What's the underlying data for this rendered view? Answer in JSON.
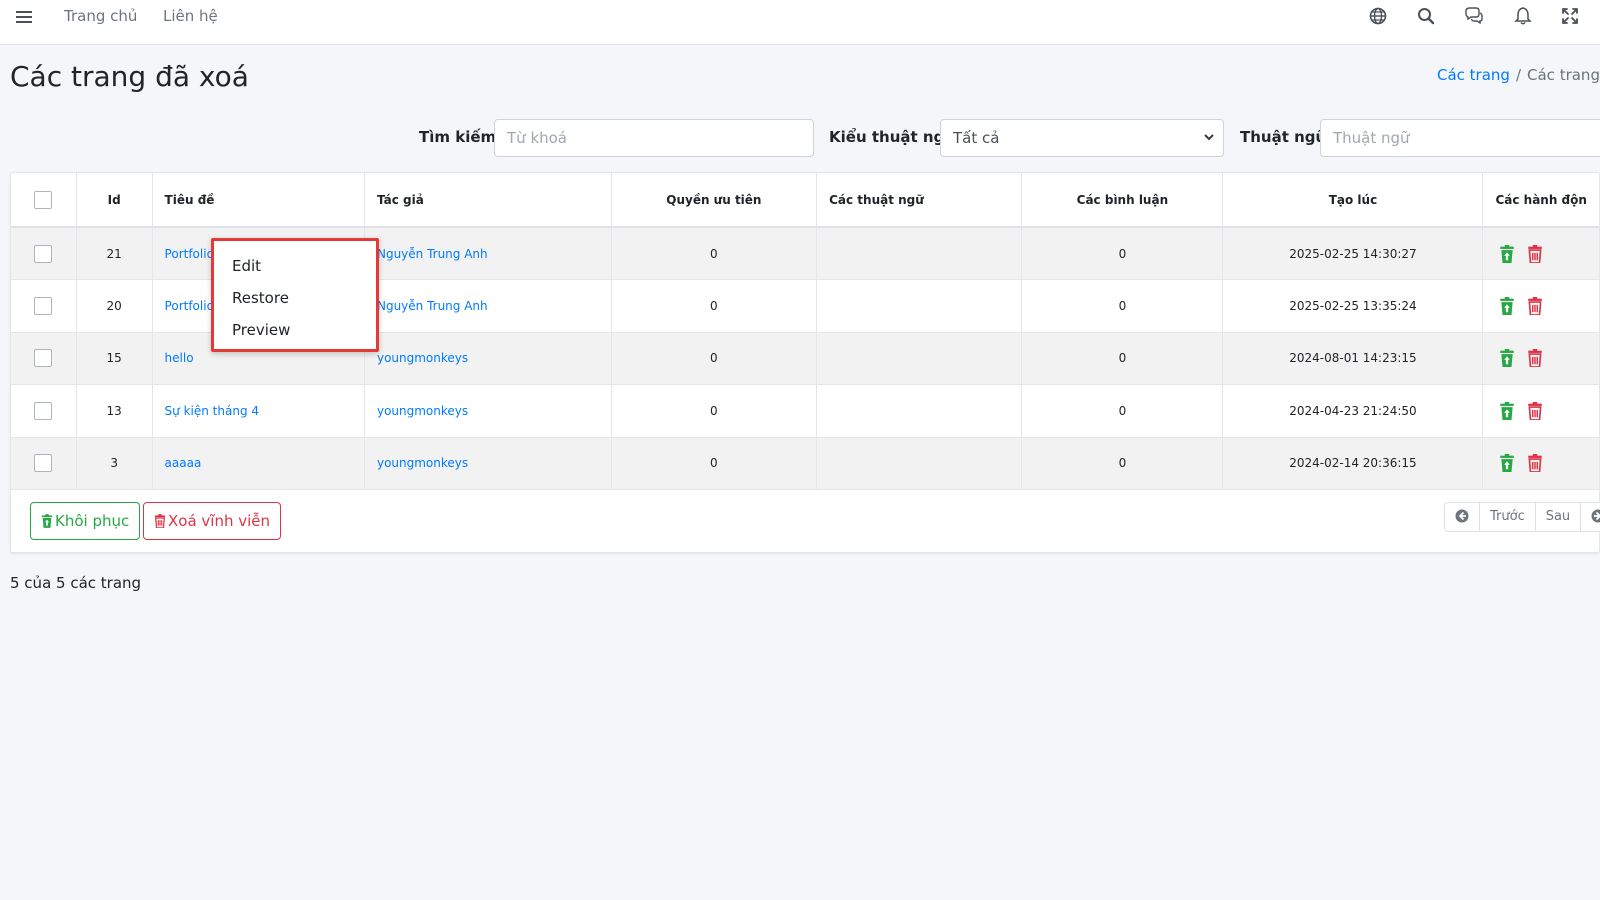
{
  "navbar": {
    "links": [
      {
        "label": "Trang chủ"
      },
      {
        "label": "Liên hệ"
      }
    ],
    "icons": [
      "menu-icon",
      "globe-icon",
      "search-icon",
      "comments-icon",
      "bell-icon",
      "expand-icon"
    ]
  },
  "header": {
    "title": "Các trang đã xoá",
    "breadcrumb": {
      "link": "Các trang",
      "separator": "/",
      "current": "Các trang đ"
    }
  },
  "filters": {
    "search_label": "Tìm kiếm:",
    "search_placeholder": "Từ khoá",
    "term_type_label": "Kiểu thuật ngữ:",
    "term_type_value": "Tất cả",
    "term_label": "Thuật ngữ:",
    "term_placeholder": "Thuật ngữ"
  },
  "table": {
    "headers": [
      "Id",
      "Tiêu đề",
      "Tác giả",
      "Quyền ưu tiên",
      "Các thuật ngữ",
      "Các bình luận",
      "Tạo lúc",
      "Các hành độn"
    ],
    "rows": [
      {
        "id": "21",
        "title": "Portfolio",
        "author": "Nguyễn Trung Anh",
        "priority": "0",
        "terms": "",
        "comments": "0",
        "created": "2025-02-25 14:30:27"
      },
      {
        "id": "20",
        "title": "Portfolio",
        "author": "Nguyễn Trung Anh",
        "priority": "0",
        "terms": "",
        "comments": "0",
        "created": "2025-02-25 13:35:24"
      },
      {
        "id": "15",
        "title": "hello",
        "author": "youngmonkeys",
        "priority": "0",
        "terms": "",
        "comments": "0",
        "created": "2024-08-01 14:23:15"
      },
      {
        "id": "13",
        "title": "Sự kiện tháng 4",
        "author": "youngmonkeys",
        "priority": "0",
        "terms": "",
        "comments": "0",
        "created": "2024-04-23 21:24:50"
      },
      {
        "id": "3",
        "title": "aaaaa",
        "author": "youngmonkeys",
        "priority": "0",
        "terms": "",
        "comments": "0",
        "created": "2024-02-14 20:36:15"
      }
    ]
  },
  "actions": {
    "restore_label": "Khôi phục",
    "delete_label": "Xoá vĩnh viễn"
  },
  "pagination": {
    "prev_label": "Trước",
    "next_label": "Sau"
  },
  "summary": "5 của 5 các trang",
  "context_menu": {
    "items": [
      "Edit",
      "Restore",
      "Preview"
    ]
  },
  "colors": {
    "primary": "#007bff",
    "success": "#28a745",
    "danger": "#dc3545",
    "highlight": "#e53935"
  }
}
